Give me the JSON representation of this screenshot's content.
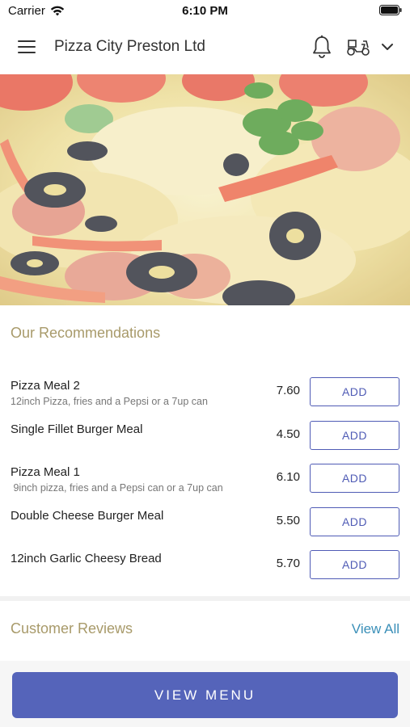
{
  "status_bar": {
    "carrier": "Carrier",
    "time": "6:10 PM",
    "wifi_icon": "wifi-icon",
    "battery_icon": "battery-icon"
  },
  "header": {
    "title": "Pizza City Preston Ltd",
    "menu_icon": "hamburger-menu-icon",
    "bell_icon": "bell-icon",
    "scooter_icon": "delivery-scooter-icon",
    "chevron_icon": "chevron-down-icon"
  },
  "hero": {
    "image": "pizza-photo"
  },
  "recommendations": {
    "title": "Our Recommendations",
    "add_label": "ADD",
    "items": [
      {
        "name": "Pizza Meal 2",
        "description": "12inch Pizza, fries and a Pepsi or a 7up can",
        "price": "7.60"
      },
      {
        "name": "Single Fillet Burger Meal",
        "description": "",
        "price": "4.50"
      },
      {
        "name": "Pizza Meal 1",
        "description": " 9inch pizza, fries and a Pepsi can or a 7up can",
        "price": "6.10"
      },
      {
        "name": "Double Cheese Burger Meal",
        "description": "",
        "price": "5.50"
      },
      {
        "name": "12inch Garlic Cheesy Bread",
        "description": "",
        "price": "5.70"
      }
    ]
  },
  "reviews": {
    "title": "Customer Reviews",
    "view_all": "View All"
  },
  "footer": {
    "view_menu": "VIEW MENU"
  },
  "colors": {
    "accent": "#5564ba",
    "section_title": "#a89a6a",
    "link": "#3a8fb8"
  }
}
